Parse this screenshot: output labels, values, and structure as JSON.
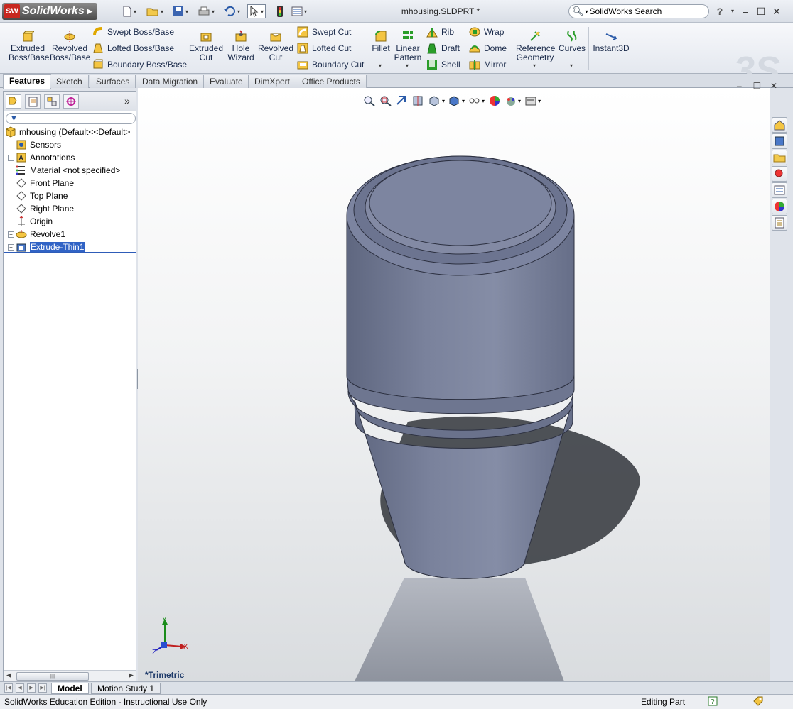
{
  "app": {
    "logo_badge": "SW",
    "logo_text": "SolidWorks",
    "document_title": "mhousing.SLDPRT *",
    "search_placeholder": "SolidWorks Search",
    "help_label": "?"
  },
  "ribbon": {
    "extruded_boss": [
      "Extruded",
      "Boss/Base"
    ],
    "revolved_boss": [
      "Revolved",
      "Boss/Base"
    ],
    "swept_boss": "Swept Boss/Base",
    "lofted_boss": "Lofted Boss/Base",
    "boundary_boss": "Boundary Boss/Base",
    "extruded_cut": [
      "Extruded",
      "Cut"
    ],
    "hole_wizard": [
      "Hole",
      "Wizard"
    ],
    "revolved_cut": [
      "Revolved",
      "Cut"
    ],
    "swept_cut": "Swept Cut",
    "lofted_cut": "Lofted Cut",
    "boundary_cut": "Boundary Cut",
    "fillet": "Fillet",
    "linear_pattern": [
      "Linear",
      "Pattern"
    ],
    "rib": "Rib",
    "draft": "Draft",
    "shell": "Shell",
    "wrap": "Wrap",
    "dome": "Dome",
    "mirror": "Mirror",
    "reference_geometry": [
      "Reference",
      "Geometry"
    ],
    "curves": "Curves",
    "instant3d": "Instant3D"
  },
  "tabs": [
    "Features",
    "Sketch",
    "Surfaces",
    "Data Migration",
    "Evaluate",
    "DimXpert",
    "Office Products"
  ],
  "tree": {
    "root": "mhousing  (Default<<Default>",
    "items": [
      {
        "label": "Sensors",
        "expandable": false,
        "icon": "sensor-icon"
      },
      {
        "label": "Annotations",
        "expandable": true,
        "icon": "annotation-icon"
      },
      {
        "label": "Material <not specified>",
        "expandable": false,
        "icon": "material-icon"
      },
      {
        "label": "Front Plane",
        "expandable": false,
        "icon": "plane-icon"
      },
      {
        "label": "Top Plane",
        "expandable": false,
        "icon": "plane-icon"
      },
      {
        "label": "Right Plane",
        "expandable": false,
        "icon": "plane-icon"
      },
      {
        "label": "Origin",
        "expandable": false,
        "icon": "origin-icon"
      },
      {
        "label": "Revolve1",
        "expandable": true,
        "icon": "revolve-icon"
      },
      {
        "label": "Extrude-Thin1",
        "expandable": true,
        "icon": "extrude-icon",
        "selected": true
      }
    ]
  },
  "viewport": {
    "view_name": "*Trimetric",
    "axis_x": "X",
    "axis_y": "Y",
    "axis_z": "Z"
  },
  "bottom_tabs": [
    "Model",
    "Motion Study 1"
  ],
  "status": {
    "left": "SolidWorks Education Edition - Instructional Use Only",
    "right": "Editing Part"
  },
  "colors": {
    "accent": "#3163c5",
    "part": "#767d96",
    "logo_red": "#c8271f"
  }
}
